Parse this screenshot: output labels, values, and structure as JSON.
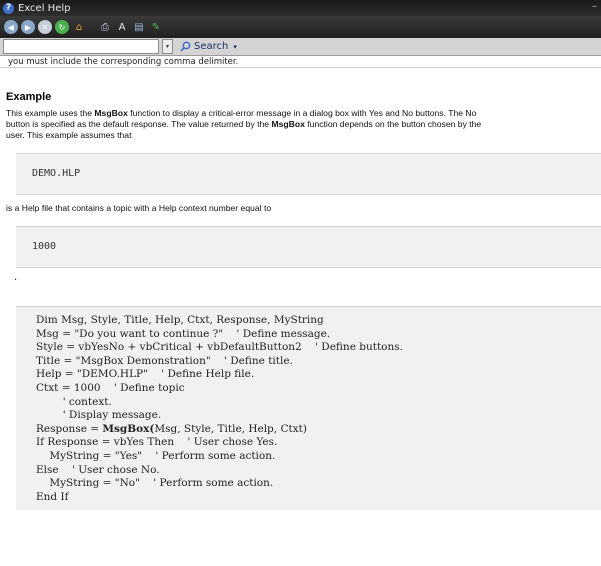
{
  "window": {
    "title": "Excel Help"
  },
  "toolbar": {
    "buttons": [
      {
        "name": "back-button",
        "icon": "back-icon",
        "glyph": "◀",
        "color": "#8aa6c8"
      },
      {
        "name": "forward-button",
        "icon": "forward-icon",
        "glyph": "▶",
        "color": "#8aa6c8"
      },
      {
        "name": "stop-button",
        "icon": "stop-icon",
        "glyph": "✕",
        "color": "#c8cfdb"
      },
      {
        "name": "refresh-button",
        "icon": "refresh-icon",
        "glyph": "↻",
        "color": "#4caf50"
      },
      {
        "name": "home-button",
        "icon": "home-icon",
        "glyph": "⌂",
        "color": "#e0a030"
      },
      {
        "name": "print-button",
        "icon": "print-icon",
        "glyph": "⎙",
        "color": "#cfd4dc"
      },
      {
        "name": "text-size-button",
        "icon": "text-size-icon",
        "glyph": "A",
        "color": "#e8e8e8"
      },
      {
        "name": "toc-button",
        "icon": "book-icon",
        "glyph": "▤",
        "color": "#9db8e0"
      },
      {
        "name": "keep-on-top-button",
        "icon": "pin-icon",
        "glyph": "✎",
        "color": "#5cb85c"
      }
    ]
  },
  "search": {
    "value": "",
    "button_label": "Search",
    "drop_glyph": "▾",
    "btn_drop_glyph": "▾"
  },
  "content": {
    "cut_text": "you must include the corresponding comma delimiter.",
    "heading": "Example",
    "para1_parts": [
      {
        "t": "This example uses the ",
        "b": false
      },
      {
        "t": "MsgBox",
        "b": true
      },
      {
        "t": " function to display a critical-error message in a dialog box with Yes and No buttons. The No",
        "b": false
      }
    ],
    "para1_line2_parts": [
      {
        "t": "button is specified as the default response. The value returned by the ",
        "b": false
      },
      {
        "t": "MsgBox",
        "b": true
      },
      {
        "t": " function depends on the button chosen by the",
        "b": false
      }
    ],
    "para1_line3": "user. This example assumes that",
    "code1": "DEMO.HLP",
    "para2": "is a Help file that contains a topic with a Help context number equal to",
    "code2": "1000",
    "dot": ".",
    "code_lines": [
      "Dim Msg, Style, Title, Help, Ctxt, Response, MyString",
      "Msg = \"Do you want to continue ?\"    ' Define message.",
      "Style = vbYesNo + vbCritical + vbDefaultButton2    ' Define buttons.",
      "Title = \"MsgBox Demonstration\"    ' Define title.",
      "Help = \"DEMO.HLP\"    ' Define Help file.",
      "Ctxt = 1000    ' Define topic",
      "        ' context.",
      "        ' Display message.",
      "Response = MsgBox(Msg, Style, Title, Help, Ctxt)",
      "If Response = vbYes Then    ' User chose Yes.",
      "    MyString = \"Yes\"    ' Perform some action.",
      "Else    ' User chose No.",
      "    MyString = \"No\"    ' Perform some action.",
      "End If"
    ]
  }
}
